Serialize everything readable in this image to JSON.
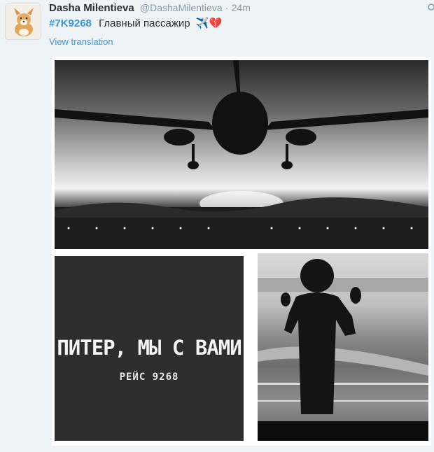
{
  "tweet": {
    "author_name": "Dasha Milentieva",
    "author_handle": "@DashaMilentieva",
    "separator": "·",
    "time": "24m",
    "hashtag": "#7K9268",
    "text": "Главный пассажир",
    "emoji": "✈️💔",
    "view_translation": "View translation"
  },
  "media": {
    "poster_title": "ПИТЕР, МЫ С ВАМИ",
    "poster_subtitle": "РЕЙС 9268"
  },
  "colors": {
    "link": "#3b94d9",
    "name": "#292f33",
    "muted": "#8899a6"
  }
}
